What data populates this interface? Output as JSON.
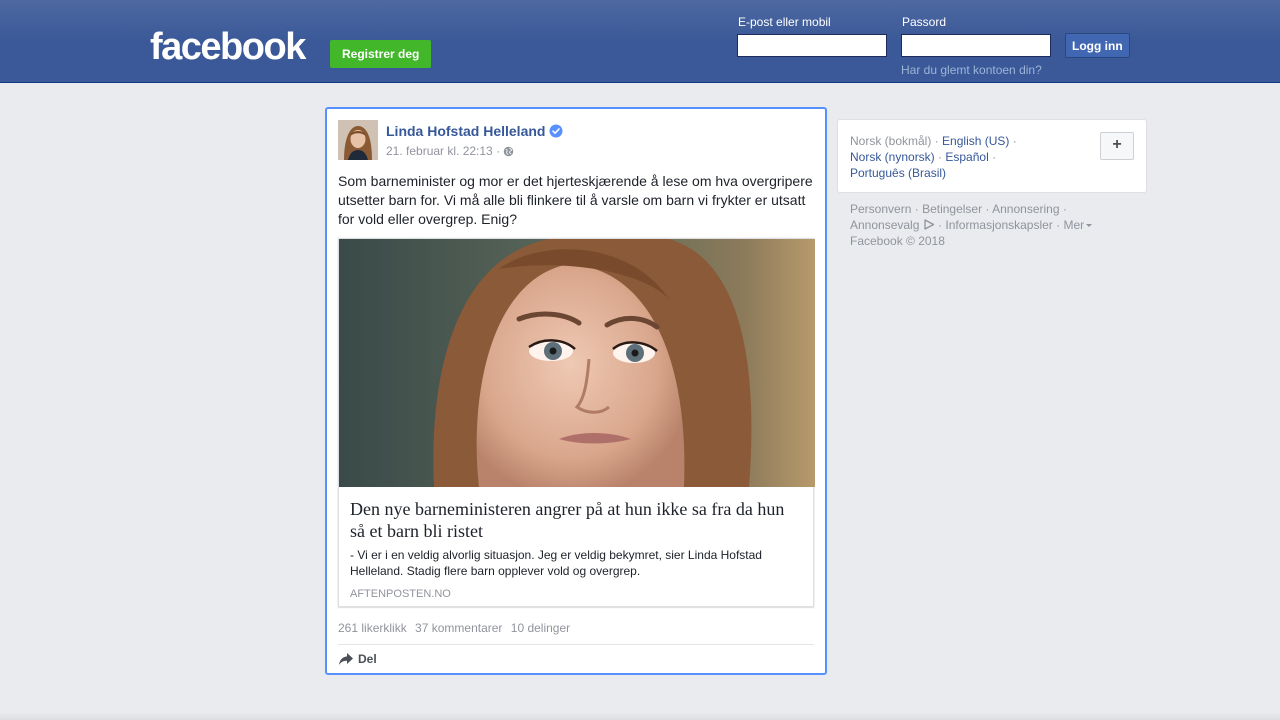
{
  "header": {
    "logo_text": "facebook",
    "register_label": "Registrer deg",
    "email_label": "E-post eller mobil",
    "email_value": "",
    "password_label": "Passord",
    "password_value": "",
    "login_label": "Logg inn",
    "forgot_label": "Har du glemt kontoen din?"
  },
  "post": {
    "author": "Linda Hofstad Helleland",
    "verified_icon": "verified-badge-icon",
    "timestamp": "21. februar kl. 22:13",
    "meta_separator": "·",
    "privacy_icon": "globe-icon",
    "text": "Som barneminister og mor er det hjerteskjærende å lese om hva overgripere utsetter barn for. Vi må alle bli flinkere til å varsle om barn vi frykter er utsatt for vold eller overgrep. Enig?",
    "attachment": {
      "title": "Den nye barneministeren angrer på at hun ikke sa fra da hun så et barn bli ristet",
      "description": "- Vi er i en veldig alvorlig situasjon. Jeg er veldig bekymret, sier Linda Hofstad Helleland. Stadig flere barn opplever vold og overgrep.",
      "source": "AFTENPOSTEN.NO"
    },
    "stats": {
      "likes": "261 likerklikk",
      "comments": "37 kommentarer",
      "shares": "10 delinger"
    },
    "share_label": "Del",
    "share_icon": "share-arrow-icon"
  },
  "sidebar": {
    "current_language": "Norsk (bokmål)",
    "languages": [
      "English (US)",
      "Norsk (nynorsk)",
      "Español",
      "Português (Brasil)"
    ],
    "separator": "·",
    "add_language_label": "+",
    "footer": {
      "links": [
        "Personvern",
        "Betingelser",
        "Annonsering",
        "Annonsevalg",
        "Informasjonskapsler",
        "Mer"
      ],
      "copyright": "Facebook © 2018"
    }
  },
  "colors": {
    "brand_blue": "#3b5998",
    "link_blue": "#365899",
    "register_green": "#42b72a",
    "highlight_border": "#5890ff",
    "background": "#e9ebee"
  }
}
